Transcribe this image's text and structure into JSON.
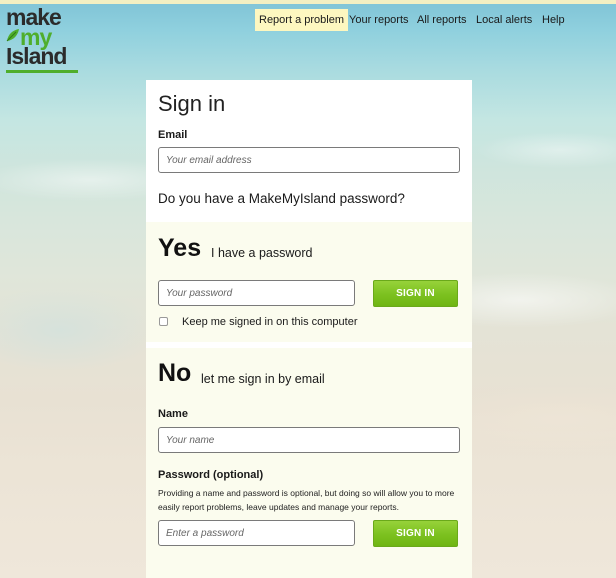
{
  "logo": {
    "line1": "make",
    "line2": "my",
    "line3": "Island",
    "accent_color": "#4fae2c"
  },
  "nav": {
    "items": [
      {
        "label": "Report a problem",
        "active": true
      },
      {
        "label": "Your reports",
        "active": false
      },
      {
        "label": "All reports",
        "active": false
      },
      {
        "label": "Local alerts",
        "active": false
      },
      {
        "label": "Help",
        "active": false
      }
    ]
  },
  "signin": {
    "title": "Sign in",
    "email_label": "Email",
    "email_placeholder": "Your email address",
    "question": "Do you have a MakeMyIsland password?"
  },
  "yes": {
    "heading": "Yes",
    "subheading": "I have a password",
    "password_placeholder": "Your password",
    "button_label": "SIGN IN",
    "keep_signed_in_label": "Keep me signed in on this computer"
  },
  "no": {
    "heading": "No",
    "subheading": "let me sign in by email",
    "name_label": "Name",
    "name_placeholder": "Your name",
    "password_label": "Password (optional)",
    "help_text": "Providing a name and password is optional, but doing so will allow you to more easily report problems, leave updates and manage your reports.",
    "password_placeholder": "Enter a password",
    "button_label": "SIGN IN"
  },
  "colors": {
    "button_green": "#7cc11f",
    "panel_tint": "#fbfcee",
    "nav_active": "#fdf7c0"
  }
}
